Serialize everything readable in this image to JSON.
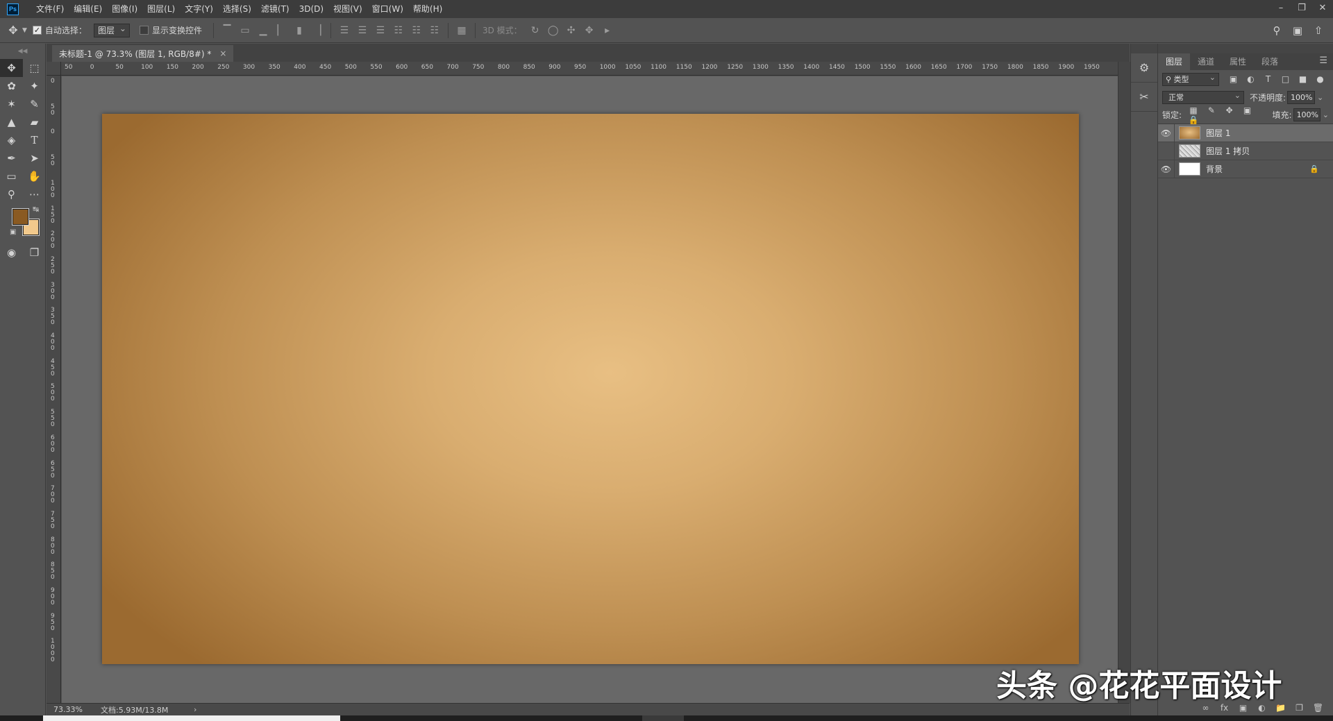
{
  "menubar": {
    "logo": "Ps",
    "items": [
      "文件(F)",
      "编辑(E)",
      "图像(I)",
      "图层(L)",
      "文字(Y)",
      "选择(S)",
      "滤镜(T)",
      "3D(D)",
      "视图(V)",
      "窗口(W)",
      "帮助(H)"
    ],
    "window_controls": [
      "minimize-icon",
      "restore-icon",
      "close-icon"
    ]
  },
  "options_bar": {
    "tool_icon": "move-tool-icon",
    "auto_select_label": "自动选择：",
    "auto_select_checked": true,
    "auto_select_target": "图层",
    "show_transform_label": "显示变换控件",
    "show_transform_checked": false,
    "mode_3d_label": "3D 模式："
  },
  "document": {
    "tab_title": "未标题-1 @ 73.3% (图层 1, RGB/8#) *",
    "tab_close": "×",
    "canvas_gradient": [
      "#e8bf83",
      "#9b6a30"
    ]
  },
  "ruler": {
    "top_labels": [
      "50",
      "0",
      "50",
      "100",
      "150",
      "200",
      "250",
      "300",
      "350",
      "400",
      "450",
      "500",
      "550",
      "600",
      "650",
      "700",
      "750",
      "800",
      "850",
      "900",
      "950",
      "1000",
      "1050",
      "1100",
      "1150",
      "1200",
      "1250",
      "1300",
      "1350",
      "1400",
      "1450",
      "1500",
      "1550",
      "1600",
      "1650",
      "1700",
      "1750",
      "1800",
      "1850",
      "1900",
      "1950"
    ],
    "left_labels": [
      "0",
      "50",
      "0",
      "50",
      "100",
      "150",
      "200",
      "250",
      "300",
      "350",
      "400",
      "450",
      "500",
      "550",
      "600",
      "650",
      "700",
      "750",
      "800",
      "850",
      "900",
      "950",
      "1000"
    ]
  },
  "tools": {
    "items": [
      "move-tool",
      "marquee-tool",
      "lasso-tool",
      "magic-wand-tool",
      "eyedropper-tool",
      "brush-tool",
      "stamp-tool",
      "eraser-tool",
      "paint-bucket-tool",
      "type-tool",
      "pen-tool",
      "path-select-tool",
      "rectangle-tool",
      "hand-tool",
      "zoom-tool",
      "more-tools"
    ],
    "foreground_color": "#8a5a22",
    "background_color": "#f2c98c"
  },
  "status": {
    "zoom": "73.33%",
    "doc_info": "文档:5.93M/13.8M",
    "arrow": "›"
  },
  "layers_panel": {
    "tabs": [
      "图层",
      "通道",
      "属性",
      "段落"
    ],
    "active_tab": 0,
    "filter_type": "类型",
    "blend_mode": "正常",
    "opacity_label": "不透明度:",
    "opacity": "100%",
    "lock_label": "锁定:",
    "fill_label": "填充:",
    "fill": "100%",
    "layers": [
      {
        "name": "图层 1",
        "visible": true,
        "selected": true,
        "thumb": "gradient",
        "locked": false
      },
      {
        "name": "图层 1 拷贝",
        "visible": false,
        "selected": false,
        "thumb": "noise",
        "locked": false
      },
      {
        "name": "背景",
        "visible": true,
        "selected": false,
        "thumb": "white",
        "locked": true
      }
    ]
  },
  "watermark": "头条 @花花平面设计"
}
